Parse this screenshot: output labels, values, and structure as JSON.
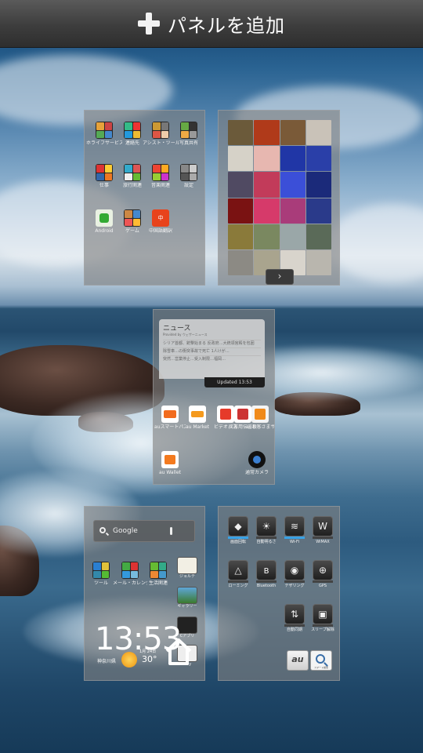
{
  "top_bar": {
    "add_panel_label": "パネルを追加",
    "icon": "plus-icon"
  },
  "panel_1": {
    "apps": [
      {
        "label": "ホライフサービス"
      },
      {
        "label": "連絡先"
      },
      {
        "label": "アシスト・ツール"
      },
      {
        "label": "写真共有"
      },
      {
        "label": "仕事"
      },
      {
        "label": "旅行関連"
      },
      {
        "label": "音楽関連"
      },
      {
        "label": "設定"
      },
      {
        "label": "Android"
      },
      {
        "label": "ゲーム"
      },
      {
        "label": "中国語翻訳"
      }
    ]
  },
  "panel_2": {
    "next_icon": "chevron-right-icon"
  },
  "panel_3": {
    "news_title": "ニュース",
    "news_provider": "Provided by ウェザーニュース",
    "news_items": [
      "シリア首都、銃撃始まる 反政府…大統領宮殿を包囲",
      "除雪車…の衝突事故で死亡 1人けが…",
      "突然…営業停止…受入制限…福岡…"
    ],
    "updated_label": "Updated 13:53",
    "apps_row": [
      {
        "label": "auスマートパス"
      },
      {
        "label": "au Market"
      },
      {
        "label": "ビデオパス"
      },
      {
        "label": "災害用伝言板"
      },
      {
        "label": "auお客さまサポート"
      }
    ],
    "apps_row2": [
      {
        "label": "au Wallet"
      },
      {
        "label": "通常カメラ"
      }
    ]
  },
  "panel_4": {
    "search_placeholder": "Google",
    "apps": [
      {
        "label": "ツール"
      },
      {
        "label": "メール・カレンダー"
      },
      {
        "label": "生活関連"
      }
    ],
    "side_apps": [
      {
        "label": "ジョルテ"
      },
      {
        "label": "ギャラリー"
      },
      {
        "label": "Cアプリ"
      },
      {
        "label": "Play"
      }
    ],
    "clock": "13:53",
    "date": "1月 24日",
    "weather_location": "神奈川県",
    "temperature": "30°"
  },
  "panel_5": {
    "switches": [
      {
        "label": "画面回転",
        "icon": "rotate-icon",
        "glyph": "◆",
        "bar": "#39a2e6"
      },
      {
        "label": "自動明るさ",
        "icon": "brightness-icon",
        "glyph": "☀",
        "bar": "#444"
      },
      {
        "label": "Wi-Fi",
        "icon": "wifi-icon",
        "glyph": "≋",
        "bar": "#39a2e6"
      },
      {
        "label": "WiMAX",
        "icon": "wimax-icon",
        "glyph": "W",
        "bar": "#444"
      },
      {
        "label": "ローミング",
        "icon": "roaming-icon",
        "glyph": "△",
        "bar": "#444"
      },
      {
        "label": "Bluetooth",
        "icon": "bluetooth-icon",
        "glyph": "ʙ",
        "bar": "#444"
      },
      {
        "label": "テザリング",
        "icon": "tethering-icon",
        "glyph": "◉",
        "bar": "#444"
      },
      {
        "label": "GPS",
        "icon": "gps-icon",
        "glyph": "⊕",
        "bar": "#444"
      },
      {
        "label": "自動同期",
        "icon": "sync-icon",
        "glyph": "⇅",
        "bar": "#444"
      },
      {
        "label": "スリープ解除",
        "icon": "sleep-icon",
        "glyph": "▣",
        "bar": "#444"
      }
    ],
    "au_logo_text": "au",
    "smart_search_label": "スマート検索"
  }
}
